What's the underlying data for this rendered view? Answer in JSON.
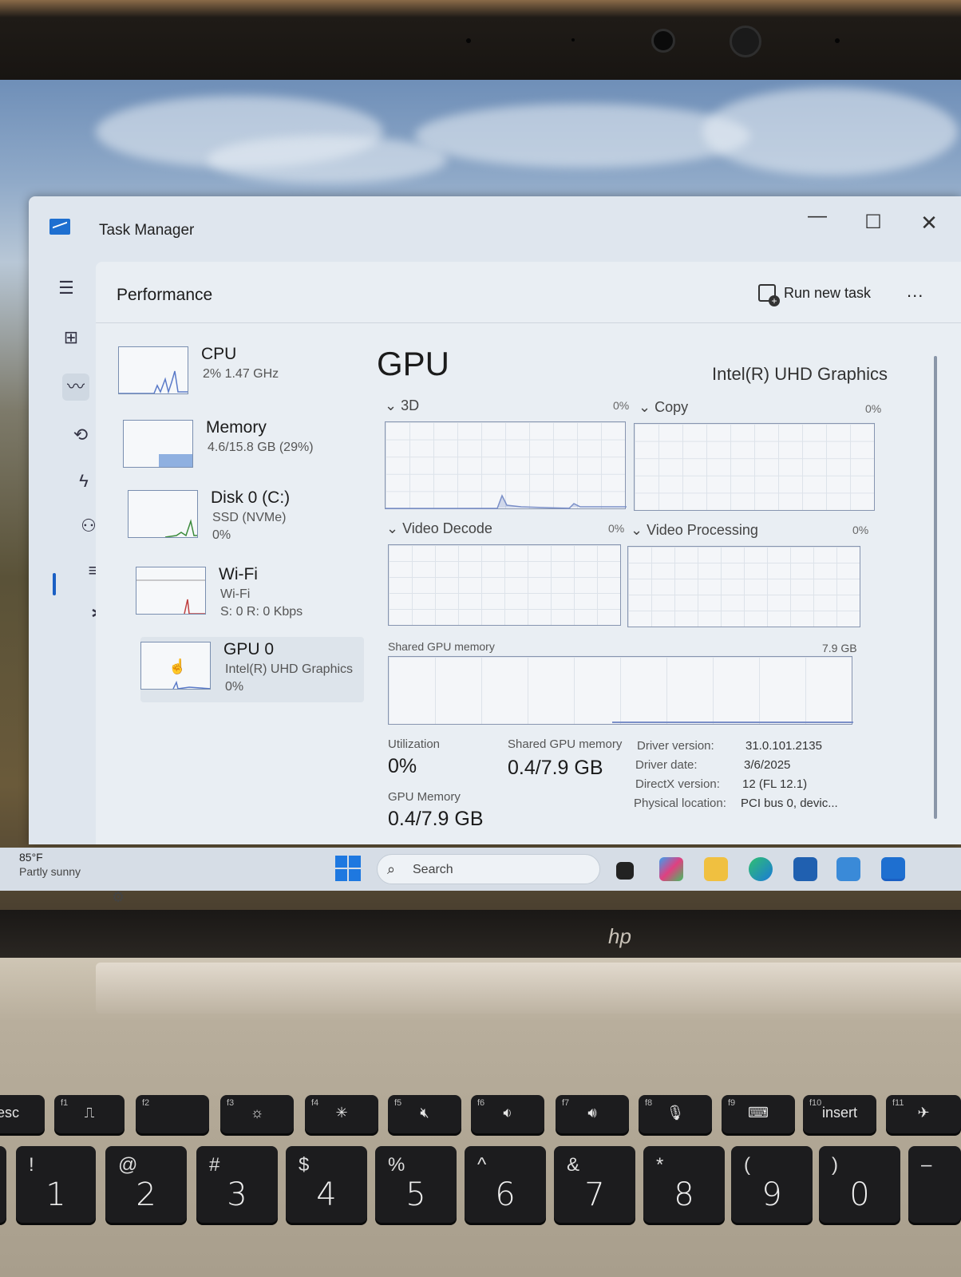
{
  "window": {
    "title": "Task Manager",
    "section": "Performance",
    "run_new_task": "Run new task",
    "more": "..."
  },
  "resources": [
    {
      "name": "CPU",
      "sub": "2% 1.47 GHz",
      "sub2": ""
    },
    {
      "name": "Memory",
      "sub": "4.6/15.8 GB (29%)",
      "sub2": ""
    },
    {
      "name": "Disk 0 (C:)",
      "sub": "SSD (NVMe)",
      "sub2": "0%"
    },
    {
      "name": "Wi-Fi",
      "sub": "Wi-Fi",
      "sub2": "S: 0 R: 0 Kbps"
    },
    {
      "name": "GPU 0",
      "sub": "Intel(R) UHD Graphics",
      "sub2": "0%"
    }
  ],
  "gpu": {
    "title": "GPU",
    "model": "Intel(R) UHD Graphics",
    "engines": [
      {
        "label": "3D",
        "pct": "0%"
      },
      {
        "label": "Copy",
        "pct": "0%"
      },
      {
        "label": "Video Decode",
        "pct": "0%"
      },
      {
        "label": "Video Processing",
        "pct": "0%"
      }
    ],
    "shared_memory_label": "Shared GPU memory",
    "shared_memory_max": "7.9 GB",
    "stats": {
      "utilization_label": "Utilization",
      "utilization_value": "0%",
      "shared_label": "Shared GPU memory",
      "shared_value": "0.4/7.9 GB",
      "gpu_memory_label": "GPU Memory",
      "gpu_memory_value": "0.4/7.9 GB"
    },
    "details": [
      {
        "key": "Driver version:",
        "value": "31.0.101.2135"
      },
      {
        "key": "Driver date:",
        "value": "3/6/2025"
      },
      {
        "key": "DirectX version:",
        "value": "12 (FL 12.1)"
      },
      {
        "key": "Physical location:",
        "value": "PCI bus 0, devic..."
      }
    ]
  },
  "taskbar": {
    "weather_temp": "85°F",
    "weather_desc": "Partly sunny",
    "search_placeholder": "Search"
  },
  "keyboard": {
    "fkeys": [
      "esc",
      "f1",
      "f2",
      "f3",
      "f4",
      "f5",
      "f6",
      "f7",
      "f8",
      "f9",
      "f10",
      "f11"
    ],
    "insert": "insert",
    "numbers": [
      {
        "top": "!",
        "num": "1"
      },
      {
        "top": "@",
        "num": "2"
      },
      {
        "top": "#",
        "num": "3"
      },
      {
        "top": "$",
        "num": "4"
      },
      {
        "top": "%",
        "num": "5"
      },
      {
        "top": "^",
        "num": "6"
      },
      {
        "top": "&",
        "num": "7"
      },
      {
        "top": "*",
        "num": "8"
      },
      {
        "top": "(",
        "num": "9"
      },
      {
        "top": ")",
        "num": "0"
      }
    ],
    "brand": "hp"
  },
  "colors": {
    "accent": "#1a5fc4",
    "graph_line": "#7a8fc8",
    "memory_fill": "#8fb0e0",
    "disk_line": "#3a8a3a",
    "wifi_line": "#c04040"
  }
}
